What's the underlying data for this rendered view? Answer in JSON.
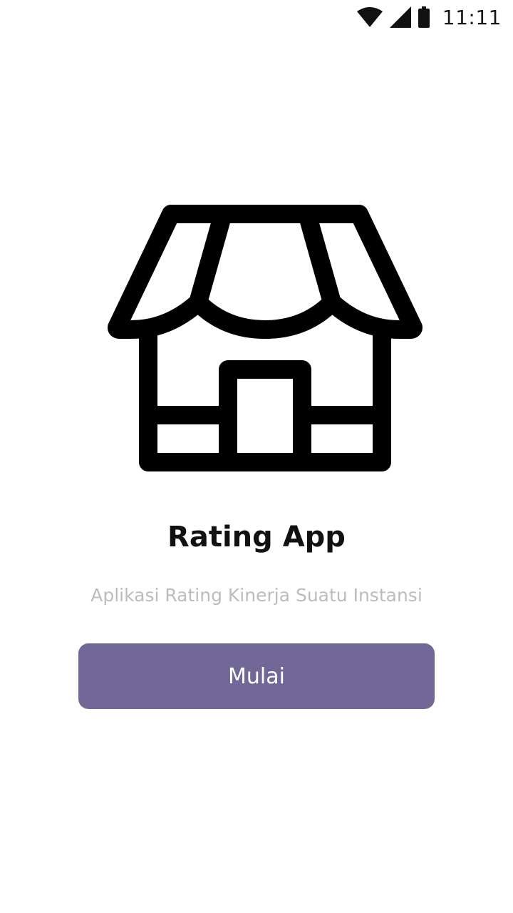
{
  "status_bar": {
    "time": "11:11",
    "icons": [
      "wifi-icon",
      "cell-signal-icon",
      "battery-icon"
    ]
  },
  "main": {
    "illustration": "store-icon",
    "title": "Rating App",
    "subtitle": "Aplikasi Rating Kinerja Suatu Instansi",
    "start_button_label": "Mulai"
  },
  "colors": {
    "accent": "#716898",
    "subtitle": "#bcbcbc",
    "title": "#111111",
    "background": "#ffffff"
  }
}
